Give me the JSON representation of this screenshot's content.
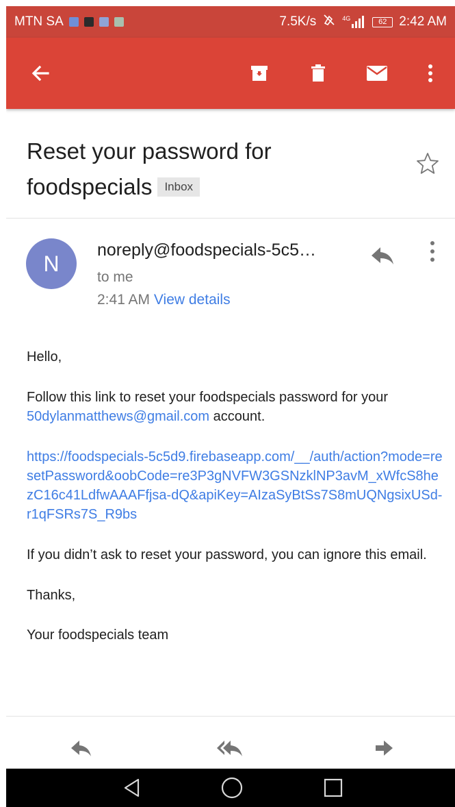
{
  "status_bar": {
    "carrier": "MTN SA",
    "speed": "7.5K/s",
    "network": "4G",
    "battery": "62",
    "time": "2:42 AM",
    "bg_color": "#c9453a"
  },
  "app_bar": {
    "bg_color": "#db4437",
    "icons": [
      "back-arrow-icon",
      "archive-icon",
      "delete-icon",
      "mark-unread-icon",
      "more-vert-icon"
    ]
  },
  "email": {
    "subject_line1": "Reset your password for",
    "subject_line2": "foodspecials",
    "label": "Inbox",
    "sender": "noreply@foodspecials-5c5…",
    "avatar_letter": "N",
    "avatar_color": "#7986cb",
    "recipient": "to me",
    "time": "2:41 AM",
    "view_details": "View details",
    "body": {
      "greeting": "Hello,",
      "intro_before": "Follow this link to reset your foodspecials password for your ",
      "email_link": "50dylanmatthews@gmail.com",
      "intro_after": " account.",
      "reset_url": "https://foodspecials-5c5d9.firebaseapp.com/__/auth/action?mode=resetPassword&oobCode=re3P3gNVFW3GSNzklNP3avM_xWfcS8hezC16c41LdfwAAAFfjsa-dQ&apiKey=AIzaSyBtSs7S8mUQNgsixUSd-r1qFSRs7S_R9bs",
      "ignore_note": "If you didn’t ask to reset your password, you can ignore this email.",
      "thanks": "Thanks,",
      "signature": "Your foodspecials team"
    }
  },
  "bottom_actions": [
    "reply-icon",
    "reply-all-icon",
    "forward-icon"
  ],
  "nav_bar": [
    "back-triangle-icon",
    "home-circle-icon",
    "recents-square-icon"
  ]
}
